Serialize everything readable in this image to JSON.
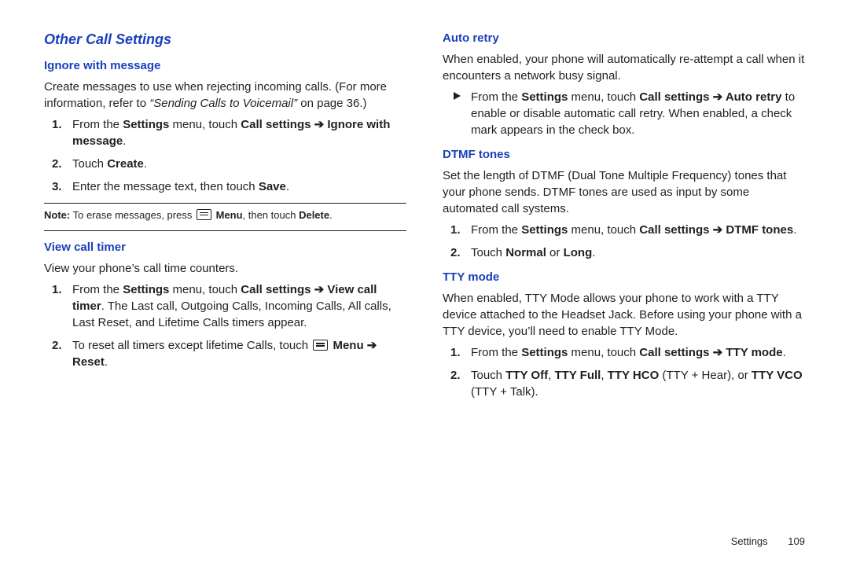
{
  "left": {
    "section_title": "Other Call Settings",
    "sub1": {
      "heading": "Ignore with message",
      "p_a": "Create messages to use when rejecting incoming calls. (For more information, refer to ",
      "p_ref": "“Sending Calls to Voicemail”",
      "p_b": " on page 36.)",
      "step1_a": "From the ",
      "step1_b": "Settings",
      "step1_c": " menu, touch ",
      "step1_d": "Call settings ",
      "step1_arrow": "➔",
      "step1_e": " Ignore with message",
      "step1_f": ".",
      "step2_a": "Touch ",
      "step2_b": "Create",
      "step2_c": ".",
      "step3_a": "Enter the message text, then touch ",
      "step3_b": "Save",
      "step3_c": ".",
      "note_a": "Note:",
      "note_b": " To erase messages, press ",
      "note_menu": " Menu",
      "note_c": ", then touch ",
      "note_d": "Delete",
      "note_e": "."
    },
    "sub2": {
      "heading": "View call timer",
      "p": "View your phone’s call time counters.",
      "step1_a": "From the ",
      "step1_b": "Settings",
      "step1_c": " menu, touch ",
      "step1_d": "Call settings ",
      "step1_arrow": "➔",
      "step1_e": " View call timer",
      "step1_f": ". The Last call, Outgoing Calls, Incoming Calls, All calls, Last Reset, and Lifetime Calls timers appear.",
      "step2_a": "To reset all timers except lifetime Calls, touch ",
      "step2_menu": " Menu ",
      "step2_arrow": "➔",
      "step2_b": " Reset",
      "step2_c": "."
    }
  },
  "right": {
    "sub1": {
      "heading": "Auto retry",
      "p": "When enabled, your phone will automatically re-attempt a call when it encounters a network busy signal.",
      "bul_a": "From the ",
      "bul_b": "Settings",
      "bul_c": " menu, touch ",
      "bul_d": "Call settings ",
      "bul_arrow": "➔",
      "bul_e": " Auto retry",
      "bul_f": " to enable or disable automatic call retry. When enabled, a check mark appears in the check box."
    },
    "sub2": {
      "heading": "DTMF tones",
      "p": "Set the length of DTMF (Dual Tone Multiple Frequency) tones that your phone sends. DTMF tones are used as input by some automated call systems.",
      "step1_a": "From the ",
      "step1_b": "Settings",
      "step1_c": " menu, touch ",
      "step1_d": "Call settings ",
      "step1_arrow": "➔",
      "step1_e": " DTMF tones",
      "step1_f": ".",
      "step2_a": "Touch ",
      "step2_b": "Normal",
      "step2_c": " or ",
      "step2_d": "Long",
      "step2_e": "."
    },
    "sub3": {
      "heading": "TTY mode",
      "p": "When enabled, TTY Mode allows your phone to work with a TTY device attached to the Headset Jack. Before using your phone with a TTY device, you’ll need to enable TTY Mode.",
      "step1_a": "From the ",
      "step1_b": "Settings",
      "step1_c": " menu, touch ",
      "step1_d": "Call settings ",
      "step1_arrow": "➔",
      "step1_e": " TTY mode",
      "step1_f": ".",
      "step2_a": "Touch ",
      "step2_b": "TTY Off",
      "step2_c": ", ",
      "step2_d": "TTY Full",
      "step2_e": ", ",
      "step2_f": "TTY HCO",
      "step2_g": " (TTY + Hear), or ",
      "step2_h": "TTY VCO",
      "step2_i": " (TTY + Talk)."
    }
  },
  "footer": {
    "section": "Settings",
    "page": "109"
  }
}
